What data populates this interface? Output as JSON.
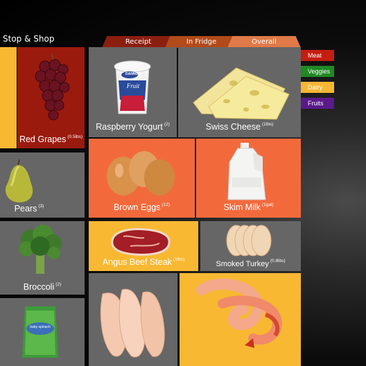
{
  "app": {
    "title": "Stop & Shop"
  },
  "tabs": [
    {
      "label": "Receipt",
      "color": "#8b1f0f"
    },
    {
      "label": "In Fridge",
      "color": "#b24a1a"
    },
    {
      "label": "Overall",
      "color": "#e07a48"
    }
  ],
  "legend": [
    {
      "label": "Meat",
      "color": "#c41e10"
    },
    {
      "label": "Veggies",
      "color": "#1f8a23"
    },
    {
      "label": "Dairy",
      "color": "#f7b733"
    },
    {
      "label": "Fruits",
      "color": "#5a1a8a"
    }
  ],
  "items": {
    "red_grapes": {
      "name": "Red Grapes",
      "qty": "(0.5lbs)"
    },
    "raspberry_yogurt": {
      "name": "Raspberry Yogurt",
      "qty": "(2)"
    },
    "swiss_cheese": {
      "name": "Swiss Cheese",
      "qty": "(1lbs)"
    },
    "pears": {
      "name": "Pears",
      "qty": "(3)"
    },
    "brown_eggs": {
      "name": "Brown Eggs",
      "qty": "(12)"
    },
    "skim_milk": {
      "name": "Skim Milk",
      "qty": "(1gal)"
    },
    "broccoli": {
      "name": "Broccoli",
      "qty": "(2)"
    },
    "angus_beef_steak": {
      "name": "Angus Beef Steak",
      "qty": "(1lbs)"
    },
    "smoked_turkey": {
      "name": "Smoked Turkey",
      "qty": "(0.8lbs)"
    }
  },
  "packages": {
    "yogurt_brand": "DANNON",
    "yogurt_word": "Fruit",
    "spinach_label": "baby spinach"
  }
}
